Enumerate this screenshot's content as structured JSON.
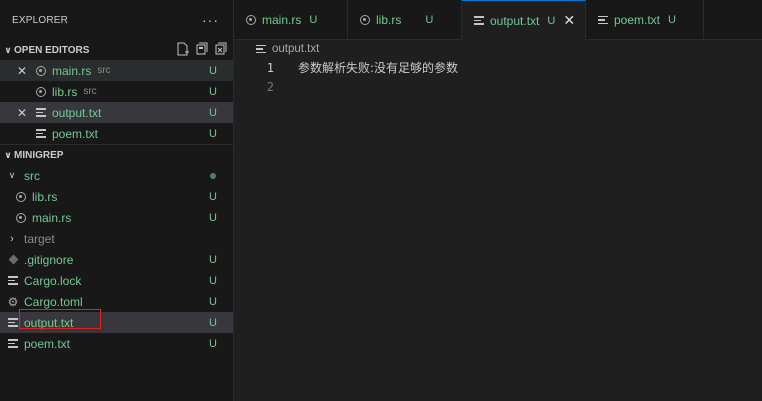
{
  "explorer": {
    "title": "EXPLORER",
    "more": "···"
  },
  "open_editors": {
    "title": "OPEN EDITORS",
    "items": [
      {
        "name": "main.rs",
        "desc": "src",
        "status": "U",
        "close": "✕"
      },
      {
        "name": "lib.rs",
        "desc": "src",
        "status": "U"
      },
      {
        "name": "output.txt",
        "status": "U",
        "close": "✕"
      },
      {
        "name": "poem.txt",
        "status": "U"
      }
    ]
  },
  "workspace": {
    "title": "MINIGREP",
    "items": [
      {
        "name": "src"
      },
      {
        "name": "lib.rs",
        "status": "U"
      },
      {
        "name": "main.rs",
        "status": "U"
      },
      {
        "name": "target"
      },
      {
        "name": ".gitignore",
        "status": "U"
      },
      {
        "name": "Cargo.lock",
        "status": "U"
      },
      {
        "name": "Cargo.toml",
        "status": "U"
      },
      {
        "name": "output.txt",
        "status": "U"
      },
      {
        "name": "poem.txt",
        "status": "U"
      }
    ]
  },
  "tabs": [
    {
      "name": "main.rs",
      "status": "U"
    },
    {
      "name": "lib.rs",
      "status": "U"
    },
    {
      "name": "output.txt",
      "status": "U",
      "close": "✕"
    },
    {
      "name": "poem.txt",
      "status": "U"
    }
  ],
  "breadcrumb": {
    "file": "output.txt"
  },
  "editor": {
    "lines": [
      {
        "number": "1",
        "text": "参数解析失败:没有足够的参数"
      },
      {
        "number": "2",
        "text": ""
      }
    ]
  },
  "colors": {
    "untracked": "#73c991",
    "active_tab_border": "#0078d4",
    "highlight_box": "#e02020"
  }
}
